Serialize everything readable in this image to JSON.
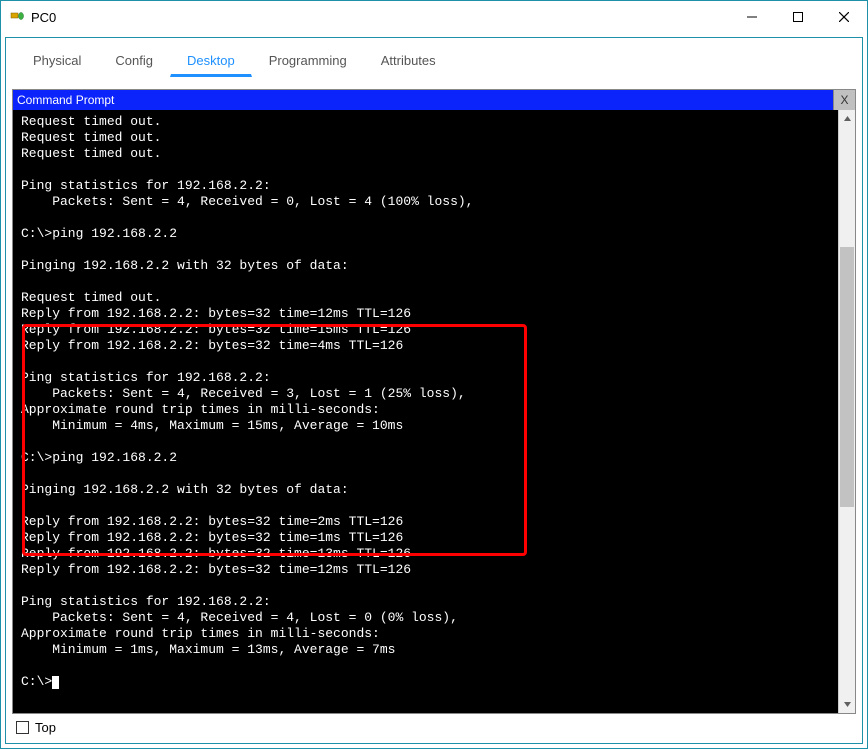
{
  "window": {
    "title": "PC0"
  },
  "win_controls": {
    "minimize": "—",
    "maximize": "▢",
    "close": "✕"
  },
  "tabs": {
    "physical": "Physical",
    "config": "Config",
    "desktop": "Desktop",
    "programming": "Programming",
    "attributes": "Attributes"
  },
  "cmd": {
    "header": "Command Prompt",
    "close_label": "X",
    "lines": [
      "Request timed out.",
      "Request timed out.",
      "Request timed out.",
      "",
      "Ping statistics for 192.168.2.2:",
      "    Packets: Sent = 4, Received = 0, Lost = 4 (100% loss),",
      "",
      "C:\\>ping 192.168.2.2",
      "",
      "Pinging 192.168.2.2 with 32 bytes of data:",
      "",
      "Request timed out.",
      "Reply from 192.168.2.2: bytes=32 time=12ms TTL=126",
      "Reply from 192.168.2.2: bytes=32 time=15ms TTL=126",
      "Reply from 192.168.2.2: bytes=32 time=4ms TTL=126",
      "",
      "Ping statistics for 192.168.2.2:",
      "    Packets: Sent = 4, Received = 3, Lost = 1 (25% loss),",
      "Approximate round trip times in milli-seconds:",
      "    Minimum = 4ms, Maximum = 15ms, Average = 10ms",
      "",
      "C:\\>ping 192.168.2.2",
      "",
      "Pinging 192.168.2.2 with 32 bytes of data:",
      "",
      "Reply from 192.168.2.2: bytes=32 time=2ms TTL=126",
      "Reply from 192.168.2.2: bytes=32 time=1ms TTL=126",
      "Reply from 192.168.2.2: bytes=32 time=13ms TTL=126",
      "Reply from 192.168.2.2: bytes=32 time=12ms TTL=126",
      "",
      "Ping statistics for 192.168.2.2:",
      "    Packets: Sent = 4, Received = 4, Lost = 0 (0% loss),",
      "Approximate round trip times in milli-seconds:",
      "    Minimum = 1ms, Maximum = 13ms, Average = 7ms",
      "",
      "C:\\>"
    ]
  },
  "bottom": {
    "top_label": "Top"
  }
}
